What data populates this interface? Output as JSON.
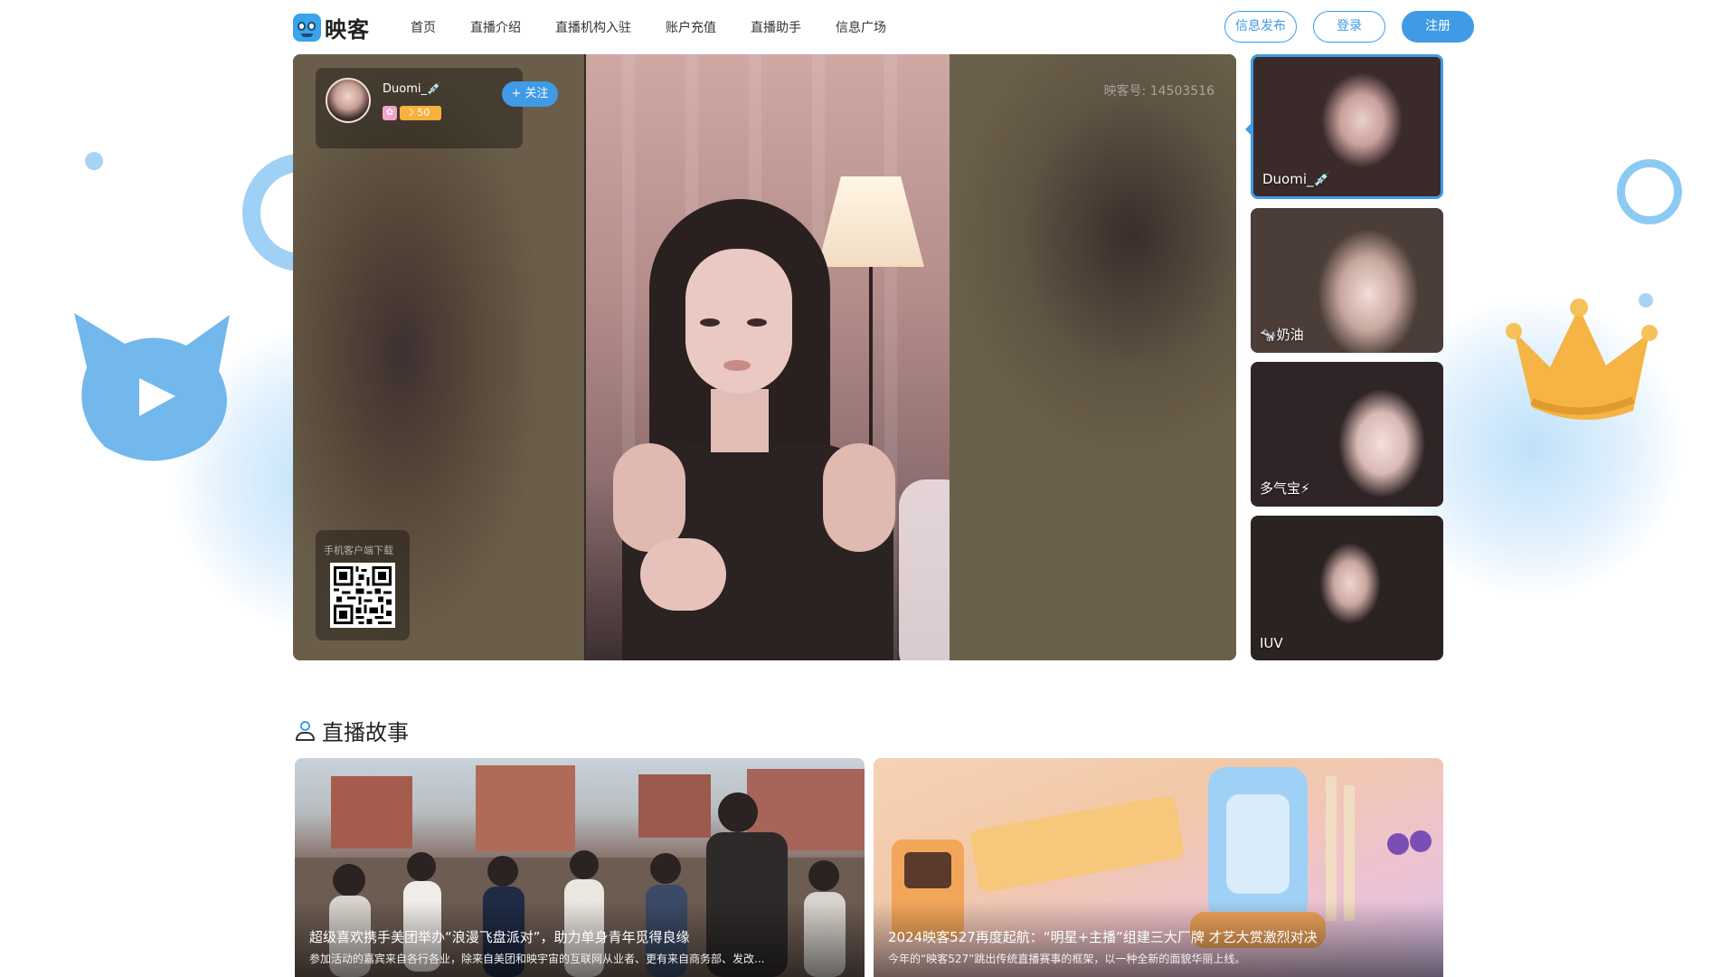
{
  "brand": {
    "logo_text": "映客",
    "accent": "#3f9be6"
  },
  "nav": {
    "items": [
      "首页",
      "直播介绍",
      "直播机构入驻",
      "账户充值",
      "直播助手",
      "信息广场"
    ]
  },
  "header_actions": {
    "publish": "信息发布",
    "login": "登录",
    "register": "注册"
  },
  "player": {
    "anchor_name": "Duomi_💉",
    "badge_glyph": "✿",
    "level": "☽ 50",
    "follow_label": "+ 关注",
    "room_no": "映客号: 14503516",
    "qr_label": "手机客户端下载"
  },
  "side_list": [
    {
      "name": "Duomi_💉",
      "active": true
    },
    {
      "name": "🐄奶油",
      "active": false
    },
    {
      "name": "多气宝⚡",
      "active": false
    },
    {
      "name": "IUV",
      "active": false
    }
  ],
  "stories_section": {
    "title": "直播故事",
    "icon": "user-icon",
    "items": [
      {
        "title": "超级喜欢携手美团举办“浪漫飞盘派对”，助力单身青年觅得良缘",
        "desc": "参加活动的嘉宾来自各行各业，除来自美团和映宇宙的互联网从业者、更有来自商务部、发改..."
      },
      {
        "title": "2024映客527再度起航：“明星+主播”组建三大厂牌 才艺大赏激烈对决",
        "desc": "今年的“映客527”跳出传统直播赛事的框架，以一种全新的面貌华丽上线。"
      }
    ]
  }
}
